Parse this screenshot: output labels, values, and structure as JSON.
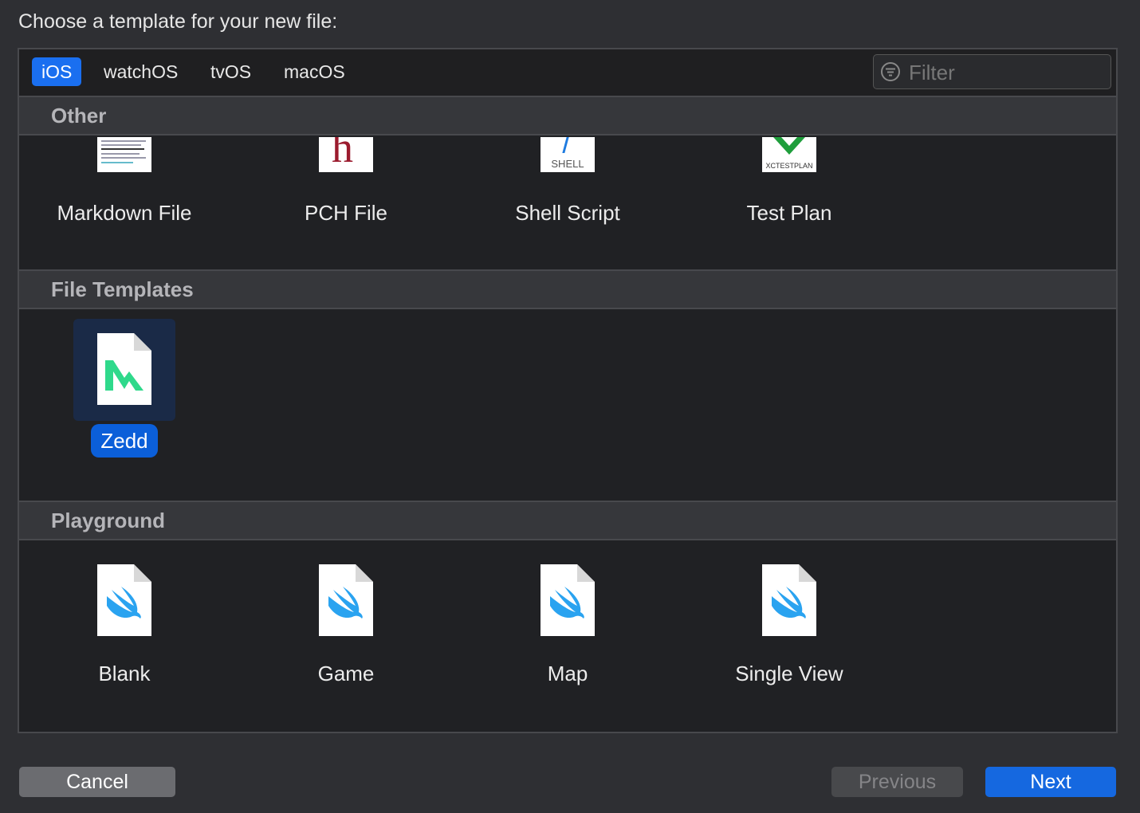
{
  "prompt": "Choose a template for your new file:",
  "tabs": [
    {
      "label": "iOS",
      "active": true
    },
    {
      "label": "watchOS",
      "active": false
    },
    {
      "label": "tvOS",
      "active": false
    },
    {
      "label": "macOS",
      "active": false
    }
  ],
  "filter": {
    "placeholder": "Filter",
    "value": ""
  },
  "sections": {
    "other": {
      "title": "Other",
      "items": [
        "Markdown File",
        "PCH File",
        "Shell Script",
        "Test Plan"
      ],
      "icon_text": {
        "pch": "h",
        "shell": "SHELL",
        "testplan": "XCTESTPLAN"
      }
    },
    "file_templates": {
      "title": "File Templates",
      "items": [
        "Zedd"
      ],
      "selected": "Zedd"
    },
    "playground": {
      "title": "Playground",
      "items": [
        "Blank",
        "Game",
        "Map",
        "Single View"
      ]
    }
  },
  "buttons": {
    "cancel": "Cancel",
    "previous": "Previous",
    "next": "Next"
  },
  "colors": {
    "accent": "#1a6ff0",
    "swift": "#2aa3f0",
    "zedd_green": "#2fd98b",
    "pch_red": "#9b1b2e",
    "testplan_green": "#1f9e3c"
  }
}
